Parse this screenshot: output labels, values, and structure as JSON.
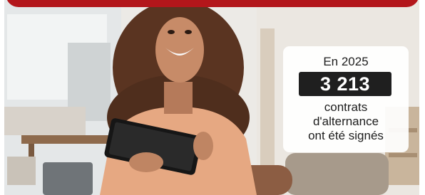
{
  "banner": {
    "color": "#b3161b"
  },
  "photo": {
    "subject": "smiling-woman-with-tablet-icon"
  },
  "stat_card": {
    "year": "En 2025",
    "number": "3 213",
    "caption_lines": [
      "contrats",
      "d'alternance",
      "ont été signés"
    ]
  }
}
